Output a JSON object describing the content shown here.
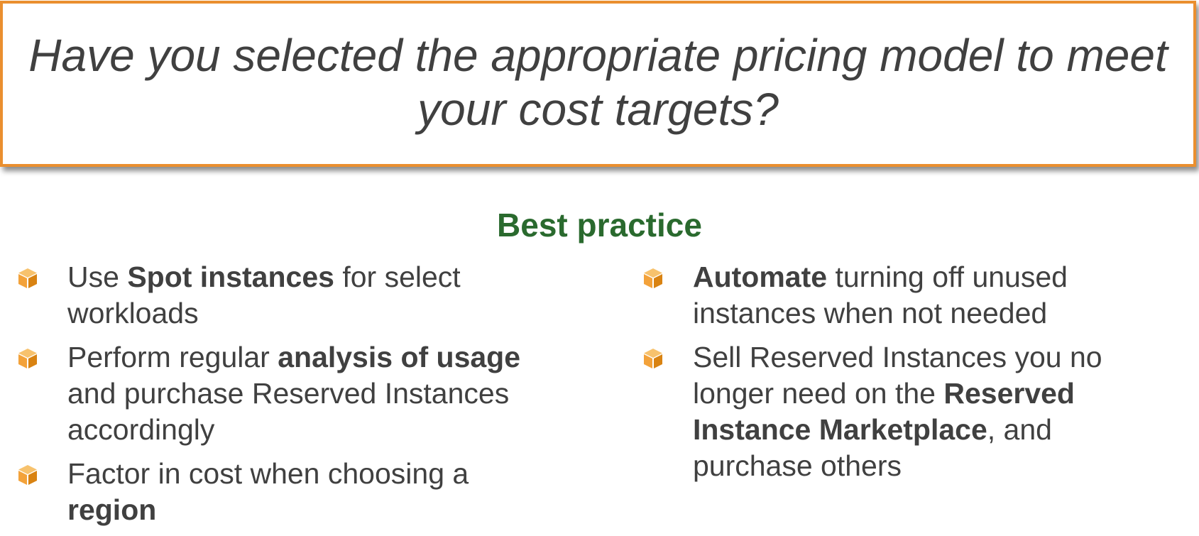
{
  "question": {
    "line1": "Have you selected the appropriate pricing model to meet",
    "line2": "your cost targets?"
  },
  "section": {
    "title": "Best practice"
  },
  "colors": {
    "border_orange": "#ea8f2f",
    "title_green": "#2a6a2e",
    "text_gray": "#404040",
    "bullet_orange": "#f3a23a"
  },
  "bullet_icon": "cube-icon",
  "left_items": [
    {
      "pre": "Use ",
      "bold": "Spot instances",
      "post": " for select",
      "line2": "workloads"
    },
    {
      "pre": "Perform regular ",
      "bold": "analysis of usage",
      "line2": "and purchase Reserved Instances",
      "line3": "accordingly"
    },
    {
      "pre": "Factor in cost when choosing a",
      "bold": "region"
    }
  ],
  "right_items": [
    {
      "bold": "Automate",
      "post": " turning off unused",
      "line2": "instances when not needed"
    },
    {
      "line1": "Sell Reserved Instances you no",
      "pre2": "longer need on the ",
      "bold2": "Reserved",
      "bold3": "Instance Marketplace",
      "post3": ", and",
      "line4": "purchase others"
    }
  ]
}
